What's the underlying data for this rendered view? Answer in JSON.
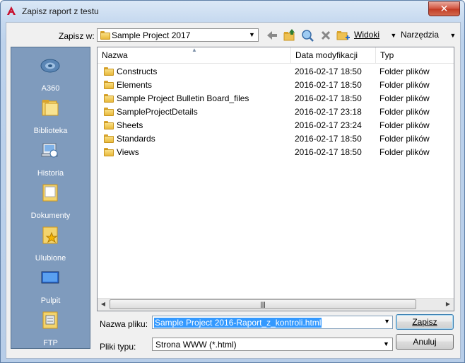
{
  "window": {
    "title": "Zapisz raport z testu",
    "close_glyph": "✕",
    "app_icon": "autocad-logo-icon"
  },
  "toolbar": {
    "save_in_label": "Zapisz w:",
    "location": "Sample Project 2017",
    "back_icon": "back-arrow-icon",
    "up_folder_icon": "up-folder-icon",
    "search_icon": "search-web-icon",
    "delete_icon": "delete-x-icon",
    "new_folder_icon": "new-folder-icon",
    "views_label": "Widoki",
    "tools_label": "Narzędzia"
  },
  "places": [
    {
      "label": "A360",
      "icon": "a360-cloud-icon"
    },
    {
      "label": "Biblioteka",
      "icon": "library-folder-icon"
    },
    {
      "label": "Historia",
      "icon": "history-icon"
    },
    {
      "label": "Dokumenty",
      "icon": "documents-folder-icon"
    },
    {
      "label": "Ulubione",
      "icon": "favorites-folder-icon"
    },
    {
      "label": "Pulpit",
      "icon": "desktop-monitor-icon"
    },
    {
      "label": "FTP",
      "icon": "ftp-folder-icon"
    }
  ],
  "columns": [
    "Nazwa",
    "Data modyfikacji",
    "Typ"
  ],
  "files": [
    {
      "name": "Constructs",
      "date": "2016-02-17 18:50",
      "type": "Folder plików"
    },
    {
      "name": "Elements",
      "date": "2016-02-17 18:50",
      "type": "Folder plików"
    },
    {
      "name": "Sample Project Bulletin Board_files",
      "date": "2016-02-17 18:50",
      "type": "Folder plików"
    },
    {
      "name": "SampleProjectDetails",
      "date": "2016-02-17 23:18",
      "type": "Folder plików"
    },
    {
      "name": "Sheets",
      "date": "2016-02-17 23:24",
      "type": "Folder plików"
    },
    {
      "name": "Standards",
      "date": "2016-02-17 18:50",
      "type": "Folder plików"
    },
    {
      "name": "Views",
      "date": "2016-02-17 18:50",
      "type": "Folder plików"
    }
  ],
  "scroll_grip": "|||",
  "footer": {
    "filename_label": "Nazwa pliku:",
    "filename_value": "Sample Project 2016-Raport_z_kontroli.html",
    "filetype_label": "Pliki typu:",
    "filetype_value": "Strona WWW (*.html)",
    "save_button": "Zapisz",
    "cancel_button": "Anuluj"
  },
  "colors": {
    "places_bg": "#7f9bbd",
    "selection": "#3399ff",
    "close_button": "#c13b24"
  }
}
